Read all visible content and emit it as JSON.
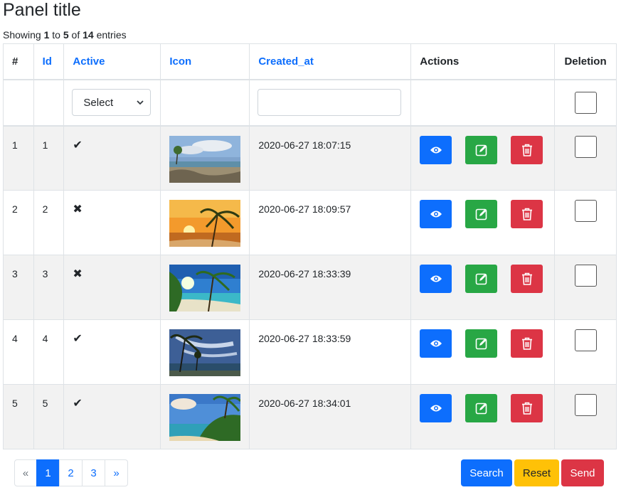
{
  "panel": {
    "title": "Panel title"
  },
  "info": {
    "prefix": "Showing",
    "start": "1",
    "to": "to",
    "end": "5",
    "of": "of",
    "total": "14",
    "suffix": "entries"
  },
  "table": {
    "headers": {
      "num": "#",
      "id": "Id",
      "active": "Active",
      "icon": "Icon",
      "created_at": "Created_at",
      "actions": "Actions",
      "deletion": "Deletion"
    },
    "filter": {
      "active_select": "Select",
      "created_at_value": ""
    },
    "rows": [
      {
        "num": "1",
        "id": "1",
        "active": "✔",
        "created_at": "2020-06-27 18:07:15",
        "image": "beach-rocky-shore"
      },
      {
        "num": "2",
        "id": "2",
        "active": "✖",
        "created_at": "2020-06-27 18:09:57",
        "image": "palm-sunset"
      },
      {
        "num": "3",
        "id": "3",
        "active": "✖",
        "created_at": "2020-06-27 18:33:39",
        "image": "tropical-beach-sun"
      },
      {
        "num": "4",
        "id": "4",
        "active": "✔",
        "created_at": "2020-06-27 18:33:59",
        "image": "palm-cloudy-sky"
      },
      {
        "num": "5",
        "id": "5",
        "active": "✔",
        "created_at": "2020-06-27 18:34:01",
        "image": "green-hill-bay"
      }
    ]
  },
  "pagination": {
    "prev": "«",
    "pages": [
      "1",
      "2",
      "3"
    ],
    "next": "»",
    "current": "1"
  },
  "buttons": {
    "search": "Search",
    "reset": "Reset",
    "send": "Send"
  },
  "colors": {
    "primary": "#0d6efd",
    "success": "#28a745",
    "danger": "#dc3545",
    "warning": "#ffc107",
    "row_stripe": "#f2f2f2"
  }
}
